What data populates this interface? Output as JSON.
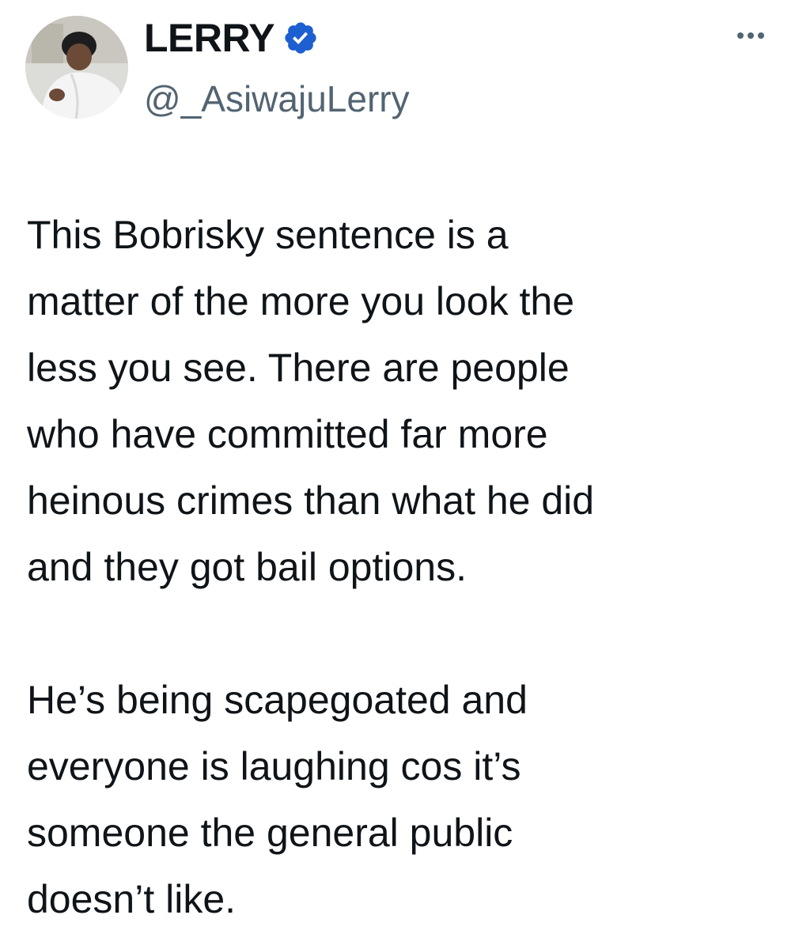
{
  "author": {
    "display_name": "LERRY",
    "handle": "@_AsiwajuLerry",
    "verified": true,
    "verified_color": "#1d5fd1"
  },
  "icons": {
    "avatar": "profile-photo",
    "verified": "verified-badge-icon",
    "more": "more-options-icon"
  },
  "tweet": {
    "paragraphs": [
      {
        "lines": [
          "This Bobrisky sentence is a",
          "matter of the more you look the",
          "less you see. There are people",
          "who have committed far more",
          "heinous crimes than what he did",
          "and they got bail options."
        ]
      },
      {
        "lines": [
          "He’s being scapegoated and",
          "everyone is laughing cos it’s",
          "someone the general public",
          "doesn’t like."
        ]
      }
    ]
  },
  "colors": {
    "text_primary": "#0f1419",
    "text_secondary": "#536471",
    "background": "#ffffff"
  }
}
